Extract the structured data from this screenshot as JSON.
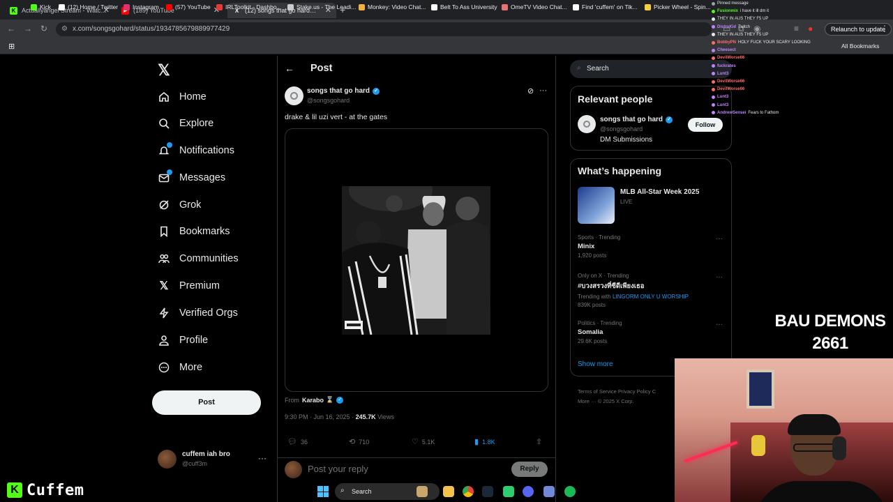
{
  "browser": {
    "tabs": [
      {
        "title": "Actuallyangel Stream - Watch L",
        "color": "#53fc18",
        "letter": "K"
      },
      {
        "title": "(189) YouTube",
        "color": "#ff0000",
        "letter": "▶"
      },
      {
        "title": "(12) songs that go hard on",
        "color": "#ffffff",
        "letter": "X"
      }
    ],
    "url": "x.com/songsgohard/status/1934785679889977429",
    "relaunch_label": "Relaunch to update",
    "bookmarks": [
      {
        "label": "Kick",
        "color": "#53fc18"
      },
      {
        "label": "(12) Home / Twitter",
        "color": "#ffffff"
      },
      {
        "label": "Instagram",
        "color": "#e1306c"
      },
      {
        "label": "(57) YouTube",
        "color": "#ff0000"
      },
      {
        "label": "IRLToolkit - Dashbo...",
        "color": "#e53935"
      },
      {
        "label": "Stake.us - The Leadi...",
        "color": "#cccccc"
      },
      {
        "label": "Monkey: Video Chat...",
        "color": "#f5b041"
      },
      {
        "label": "Belt To Ass University",
        "color": "#ffffff"
      },
      {
        "label": "OmeTV Video Chat...",
        "color": "#e57373"
      },
      {
        "label": "Find 'cuffem' on Tik...",
        "color": "#ffffff"
      },
      {
        "label": "Picker Wheel - Spin...",
        "color": "#f4d03f"
      }
    ],
    "all_bookmarks": "All Bookmarks"
  },
  "nav": {
    "items": [
      {
        "label": "Home",
        "icon": "home-icon"
      },
      {
        "label": "Explore",
        "icon": "search-icon"
      },
      {
        "label": "Notifications",
        "icon": "bell-icon"
      },
      {
        "label": "Messages",
        "icon": "mail-icon"
      },
      {
        "label": "Grok",
        "icon": "grok-icon"
      },
      {
        "label": "Bookmarks",
        "icon": "bookmark-icon"
      },
      {
        "label": "Communities",
        "icon": "people-icon"
      },
      {
        "label": "Premium",
        "icon": "x-icon"
      },
      {
        "label": "Verified Orgs",
        "icon": "lightning-icon"
      },
      {
        "label": "Profile",
        "icon": "person-icon"
      },
      {
        "label": "More",
        "icon": "more-circle-icon"
      }
    ],
    "post_button": "Post",
    "account": {
      "name": "cuffem iah bro",
      "handle": "@cuff3m"
    }
  },
  "post": {
    "header": "Post",
    "author_name": "songs that go hard",
    "author_handle": "@songsgohard",
    "text": "drake & lil uzi vert - at the gates",
    "from_label": "From",
    "from_name": "Karabo",
    "time": "9:30 PM · Jun 16, 2025 · ",
    "views": "245.7K",
    "views_label": " Views",
    "replies": "36",
    "reposts": "710",
    "likes": "5.1K",
    "bookmarks": "1.8K",
    "reply_placeholder": "Post your reply",
    "reply_button": "Reply"
  },
  "sidebar": {
    "search_placeholder": "Search",
    "relevant_title": "Relevant people",
    "relevant": {
      "name": "songs that go hard",
      "handle": "@songsgohard",
      "bio": "DM Submissions",
      "follow": "Follow"
    },
    "happening_title": "What’s happening",
    "mlb": {
      "title": "MLB All-Star Week 2025",
      "status": "LIVE"
    },
    "trends": [
      {
        "meta": "Sports · Trending",
        "name": "Minix",
        "count": "1,920 posts",
        "with_label": "",
        "with_link": ""
      },
      {
        "meta": "Only on X · Trending",
        "name": "#บวงสรวงที่ซีดีเพียงเธอ",
        "count": "839K posts",
        "with_label": "Trending with ",
        "with_link": "LINGORM ONLY U WORSHIP"
      },
      {
        "meta": "Politics · Trending",
        "name": "Somalia",
        "count": "29.6K posts",
        "with_label": "",
        "with_link": ""
      }
    ],
    "show_more": "Show more",
    "footer_line1": "Terms of Service    Privacy Policy    C",
    "footer_line2": "More ···  © 2025 X Corp."
  },
  "stream": {
    "chat": [
      {
        "user": "",
        "msg": "Pinned message",
        "color": "#9aa0a6"
      },
      {
        "user": "Fusionmix",
        "msg": "i have it ill dm it",
        "color": "#53fc18"
      },
      {
        "user": "",
        "msg": "THEY IN AUS THEY F5 UP",
        "color": "#e7e9ea"
      },
      {
        "user": "DistroKid",
        "msg": "Twitch",
        "color": "#c084fc"
      },
      {
        "user": "",
        "msg": "THEY IN AUS THEY F5 UP",
        "color": "#e7e9ea"
      },
      {
        "user": "BobbyPN",
        "msg": "HOLY FUCK YOUR SCARY LOOKING",
        "color": "#ff6b6b"
      },
      {
        "user": "Cheesect",
        "msg": "",
        "color": "#c084fc"
      },
      {
        "user": "DevilWorse66",
        "msg": "",
        "color": "#ff6b6b"
      },
      {
        "user": "fuckrates",
        "msg": "",
        "color": "#c084fc"
      },
      {
        "user": "Lunt3",
        "msg": "",
        "color": "#c084fc"
      },
      {
        "user": "DevilWorse66",
        "msg": "",
        "color": "#ff6b6b"
      },
      {
        "user": "DevilWorse66",
        "msg": "",
        "color": "#ff6b6b"
      },
      {
        "user": "Lunt3",
        "msg": "",
        "color": "#c084fc"
      },
      {
        "user": "Lunt3",
        "msg": "",
        "color": "#c084fc"
      },
      {
        "user": "AndrewSensei",
        "msg": "Fears to Fathom",
        "color": "#c084fc"
      }
    ],
    "banner_line1": "BAU DEMONS",
    "banner_line2": "2661",
    "kick_name": "Cuffem"
  },
  "taskbar": {
    "search": "Search"
  }
}
